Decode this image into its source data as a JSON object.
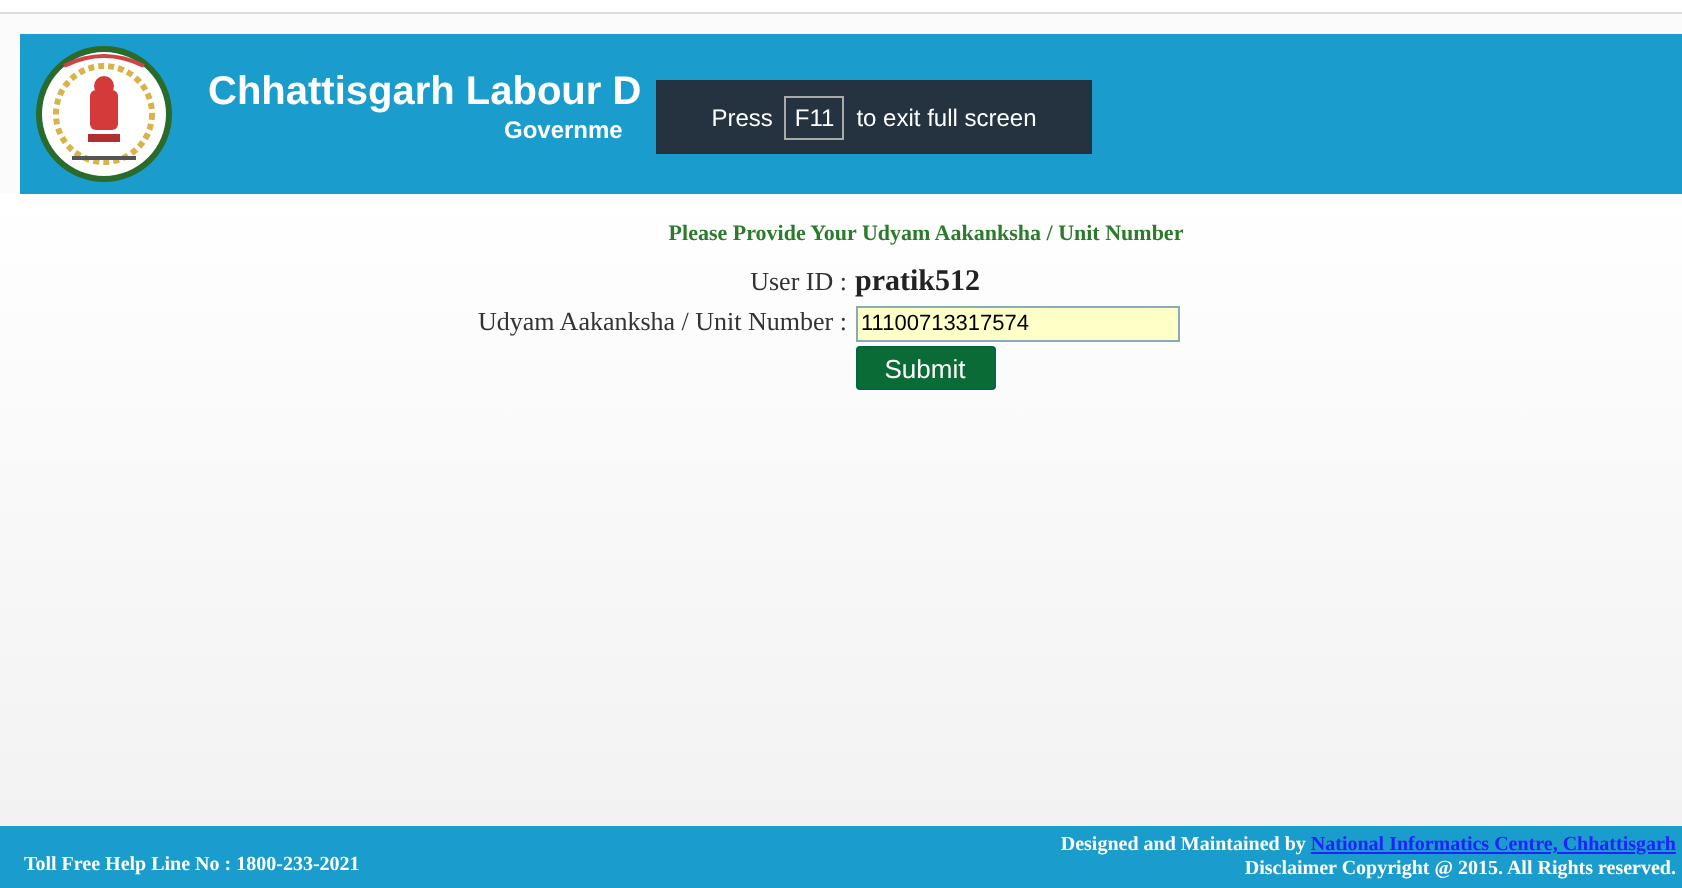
{
  "header": {
    "title": "Chhattisgarh Labour D",
    "subtitle": "Governme"
  },
  "fullscreen_notice": {
    "before": "Press",
    "key": "F11",
    "after": "to exit full screen"
  },
  "form": {
    "heading": "Please Provide Your Udyam Aakanksha / Unit Number",
    "user_id_label": "User ID :",
    "user_id": "pratik512",
    "unit_label": "Udyam Aakanksha / Unit Number :",
    "unit_value": "11100713317574",
    "submit": "Submit"
  },
  "footer": {
    "helpline": "Toll Free Help Line No : 1800-233-2021",
    "designed_by": "Designed and Maintained by",
    "link": "National Informatics Centre, Chhattisgarh",
    "disclaimer": "Disclaimer Copyright @ 2015. All Rights reserved."
  }
}
